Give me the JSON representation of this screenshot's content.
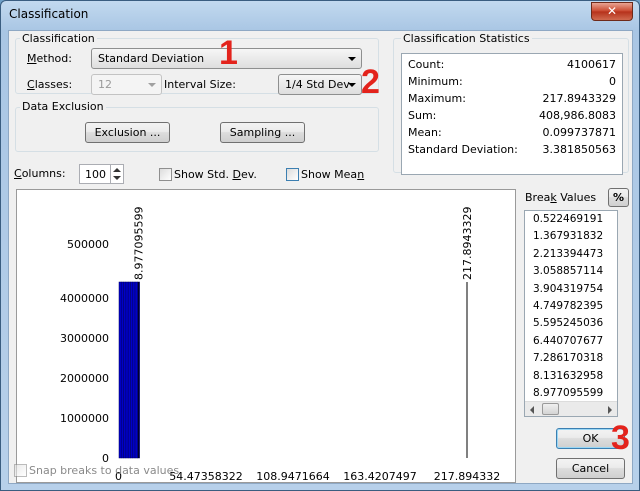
{
  "window": {
    "title": "Classification",
    "close_glyph": "✕"
  },
  "classification_group": {
    "legend": "Classification",
    "method_label": "Method:",
    "method_value": "Standard Deviation",
    "classes_label": "Classes:",
    "classes_value": "12",
    "interval_label": "Interval Size:",
    "interval_value": "1/4 Std Dev"
  },
  "exclusion_group": {
    "legend": "Data Exclusion",
    "exclusion_button": "Exclusion ...",
    "sampling_button": "Sampling ..."
  },
  "statistics": {
    "legend": "Classification Statistics",
    "rows": [
      {
        "label": "Count:",
        "value": "4100617"
      },
      {
        "label": "Minimum:",
        "value": "0"
      },
      {
        "label": "Maximum:",
        "value": "217.8943329"
      },
      {
        "label": "Sum:",
        "value": "408,986.8083"
      },
      {
        "label": "Mean:",
        "value": "0.099737871"
      },
      {
        "label": "Standard Deviation:",
        "value": "3.381850563"
      }
    ]
  },
  "columns": {
    "label": "Columns:",
    "value": "100"
  },
  "options": {
    "show_std_dev": {
      "label": "Show Std. Dev.",
      "checked": false
    },
    "show_mean": {
      "label": "Show Mean",
      "checked": false
    },
    "snap_breaks": {
      "label": "Snap breaks to data values",
      "checked": false
    }
  },
  "break_values": {
    "label": "Break Values",
    "percent_button": "%",
    "items": [
      "0.522469191",
      "1.367931832",
      "2.213394473",
      "3.058857114",
      "3.904319754",
      "4.749782395",
      "5.595245036",
      "6.440707677",
      "7.286170318",
      "8.131632958",
      "8.977095599"
    ]
  },
  "buttons": {
    "ok": "OK",
    "cancel": "Cancel"
  },
  "annotations": {
    "one": "1",
    "two": "2",
    "three": "3"
  },
  "chart_data": {
    "type": "bar",
    "title": "",
    "xlabel": "",
    "ylabel": "",
    "x_ticks": [
      "0",
      "54.47358322",
      "108.9471664",
      "163.4207497",
      "217.894332"
    ],
    "y_ticks": [
      "0",
      "1000000",
      "2000000",
      "3000000",
      "4000000",
      "500000"
    ],
    "xlim": [
      0,
      217.8943329
    ],
    "ylim": [
      0,
      5000000
    ],
    "series": [
      {
        "values": [
          4100000,
          4100000,
          4100000,
          4100000,
          4100000,
          4100000,
          4100000,
          4100000,
          4100000
        ]
      }
    ],
    "bar_color": "#0000c8",
    "break_line_labels": [
      "8.977095599",
      "217.8943329"
    ],
    "break_lines_x": [
      8.977095599,
      217.8943329
    ]
  }
}
